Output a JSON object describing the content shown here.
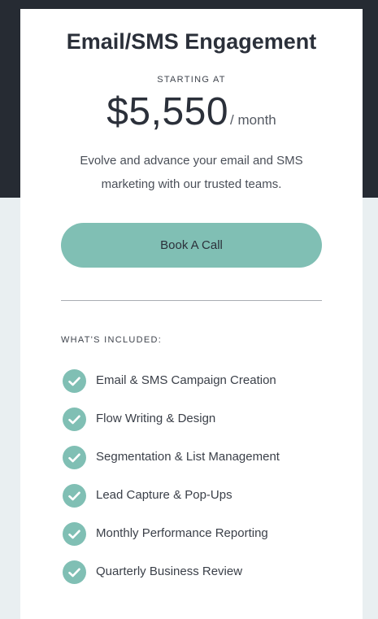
{
  "plan": {
    "title": "Email/SMS Engagement",
    "starting_label": "STARTING AT",
    "price": "$5,550",
    "period": "/ month",
    "description": "Evolve and advance your email and SMS marketing with our trusted teams.",
    "cta_label": "Book A Call"
  },
  "included": {
    "heading": "WHAT'S INCLUDED:",
    "icon": "check-circle-icon",
    "items": [
      "Email & SMS Campaign Creation",
      "Flow Writing & Design",
      "Segmentation & List Management",
      "Lead Capture & Pop-Ups",
      "Monthly Performance Reporting",
      "Quarterly Business Review"
    ]
  },
  "colors": {
    "accent": "#80bfb4",
    "dark_band": "#262b33",
    "page_bg": "#e9eff1",
    "text": "#2b303a"
  }
}
